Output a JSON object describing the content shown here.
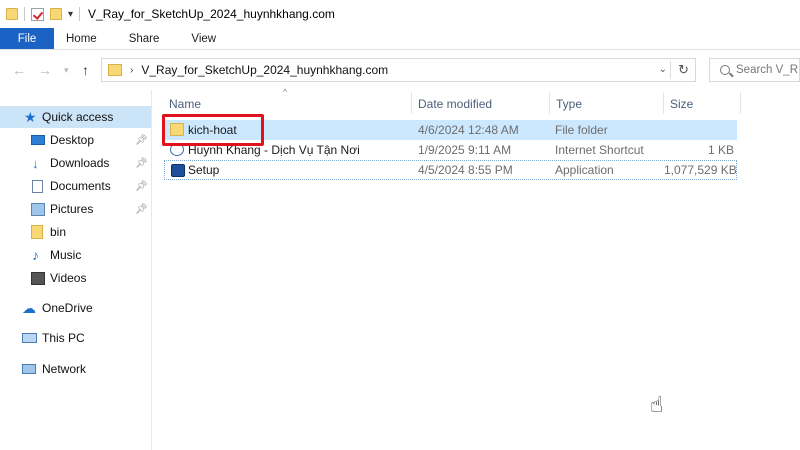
{
  "window": {
    "title": "V_Ray_for_SketchUp_2024_huynhkhang.com"
  },
  "ribbon": {
    "tabs": [
      "File",
      "Home",
      "Share",
      "View"
    ]
  },
  "address": {
    "path": "V_Ray_for_SketchUp_2024_huynhkhang.com"
  },
  "search": {
    "placeholder": "Search V_R"
  },
  "sidebar": {
    "items": [
      {
        "label": "Quick access",
        "icon": "star-icon",
        "pinned": false
      },
      {
        "label": "Desktop",
        "icon": "desktop-icon",
        "pinned": true
      },
      {
        "label": "Downloads",
        "icon": "download-icon",
        "pinned": true
      },
      {
        "label": "Documents",
        "icon": "document-icon",
        "pinned": true
      },
      {
        "label": "Pictures",
        "icon": "picture-icon",
        "pinned": true
      },
      {
        "label": "bin",
        "icon": "folder-icon",
        "pinned": false
      },
      {
        "label": "Music",
        "icon": "music-icon",
        "pinned": false
      },
      {
        "label": "Videos",
        "icon": "video-icon",
        "pinned": false
      },
      {
        "label": "OneDrive",
        "icon": "cloud-icon",
        "pinned": false
      },
      {
        "label": "This PC",
        "icon": "computer-icon",
        "pinned": false
      },
      {
        "label": "Network",
        "icon": "network-icon",
        "pinned": false
      }
    ]
  },
  "columns": {
    "name": "Name",
    "date": "Date modified",
    "type": "Type",
    "size": "Size"
  },
  "files": [
    {
      "name": "kich-hoat",
      "date": "4/6/2024 12:48 AM",
      "type": "File folder",
      "size": "",
      "icon": "folder-icon"
    },
    {
      "name": "Huynh Khang - Dịch Vụ Tận Nơi",
      "date": "1/9/2025 9:11 AM",
      "type": "Internet Shortcut",
      "size": "1 KB",
      "icon": "link-icon"
    },
    {
      "name": "Setup",
      "date": "4/5/2024 8:55 PM",
      "type": "Application",
      "size": "1,077,529 KB",
      "icon": "app-icon"
    }
  ],
  "colors": {
    "accent": "#1a63c4",
    "highlight": "#e0121b",
    "selection": "#cce8ff"
  }
}
